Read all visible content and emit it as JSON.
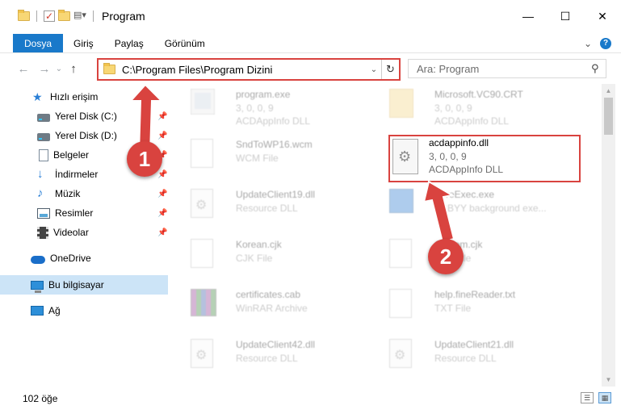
{
  "window": {
    "title": "Program",
    "minimize": "—",
    "maximize": "☐",
    "close": "✕"
  },
  "ribbon": {
    "tabs": [
      "Dosya",
      "Giriş",
      "Paylaş",
      "Görünüm"
    ],
    "collapse": "⌄",
    "help": "?"
  },
  "nav": {
    "back": "←",
    "forward": "→",
    "recent": "⌄",
    "up": "↑",
    "address": "C:\\Program Files\\Program Dizini",
    "address_dropdown": "⌄",
    "refresh": "↻",
    "search_placeholder": "Ara: Program",
    "search_icon": "⚲"
  },
  "sidebar": {
    "items": [
      {
        "label": "Hızlı erişim",
        "icon": "star-icon"
      },
      {
        "label": "Yerel Disk (C:)",
        "icon": "disk-icon",
        "pinned": true
      },
      {
        "label": "Yerel Disk (D:)",
        "icon": "disk-icon",
        "pinned": true
      },
      {
        "label": "Belgeler",
        "icon": "document-icon",
        "pinned": true
      },
      {
        "label": "İndirmeler",
        "icon": "download-icon",
        "pinned": true
      },
      {
        "label": "Müzik",
        "icon": "music-icon",
        "pinned": true
      },
      {
        "label": "Resimler",
        "icon": "pictures-icon",
        "pinned": true
      },
      {
        "label": "Videolar",
        "icon": "videos-icon",
        "pinned": true
      },
      {
        "label": "OneDrive",
        "icon": "onedrive-icon"
      },
      {
        "label": "Bu bilgisayar",
        "icon": "computer-icon",
        "selected": true
      },
      {
        "label": "Ağ",
        "icon": "network-icon"
      }
    ],
    "pin_glyph": "📌"
  },
  "files": [
    {
      "name": "program.exe",
      "line1": "3, 0, 0, 9",
      "line2": "ACDAppInfo DLL",
      "icon": "exe-icon"
    },
    {
      "name": "Microsoft.VC90.CRT",
      "line1": "3, 0, 0, 9",
      "line2": "ACDAppInfo DLL",
      "icon": "folder-icon"
    },
    {
      "name": "SndToWP16.wcm",
      "line1": "WCM File",
      "line2": "",
      "icon": "file-icon"
    },
    {
      "name": "UpdateClient19.dll",
      "line1": "Resource DLL",
      "line2": "",
      "icon": "dll-icon"
    },
    {
      "name": "ForeExec.exe",
      "line1": "ABBYY background exe...",
      "line2": "",
      "icon": "app-icon"
    },
    {
      "name": "Korean.cjk",
      "line1": "CJK File",
      "line2": "",
      "icon": "file-icon"
    },
    {
      "name": "Custom.cjk",
      "line1": "CJK File",
      "line2": "",
      "icon": "file-icon"
    },
    {
      "name": "certificates.cab",
      "line1": "WinRAR Archive",
      "line2": "",
      "icon": "archive-icon"
    },
    {
      "name": "help.fineReader.txt",
      "line1": "TXT File",
      "line2": "",
      "icon": "file-icon"
    },
    {
      "name": "UpdateClient42.dll",
      "line1": "Resource DLL",
      "line2": "",
      "icon": "dll-icon"
    },
    {
      "name": "UpdateClient21.dll",
      "line1": "Resource DLL",
      "line2": "",
      "icon": "dll-icon"
    }
  ],
  "highlighted_file": {
    "name": "acdappinfo.dll",
    "line1": "3, 0, 0, 9",
    "line2": "ACDAppInfo DLL",
    "icon": "dll-icon"
  },
  "annotations": {
    "badge1": "1",
    "badge2": "2",
    "color": "#d9433f"
  },
  "status": {
    "item_count": "102 öğe"
  },
  "colors": {
    "accent": "#1979ca",
    "selection": "#cce4f7",
    "highlight": "#d9433f"
  }
}
